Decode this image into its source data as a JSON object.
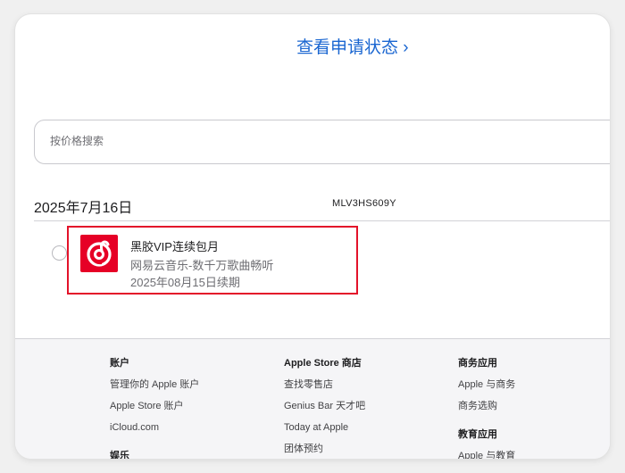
{
  "request_status_link": "查看申请状态 ›",
  "search": {
    "placeholder": "按价格搜索"
  },
  "order": {
    "date": "2025年7月16日",
    "id": "MLV3HS609Y",
    "item": {
      "title": "黑胶VIP连续包月",
      "app": "网易云音乐-数千万歌曲畅听",
      "renewal": "2025年08月15日续期",
      "icon": "netease-cloud-music-icon",
      "icon_color": "#e60026"
    }
  },
  "highlight_color": "#e3122a",
  "footer": {
    "col1": {
      "heading": "账户",
      "links": [
        "管理你的 Apple 账户",
        "Apple Store 账户",
        "iCloud.com"
      ],
      "heading2": "娱乐"
    },
    "col2": {
      "heading": "Apple Store 商店",
      "links": [
        "查找零售店",
        "Genius Bar 天才吧",
        "Today at Apple",
        "团体预约"
      ]
    },
    "col3": {
      "heading": "商务应用",
      "links": [
        "Apple 与商务",
        "商务选购"
      ],
      "heading2": "教育应用",
      "links2": [
        "Apple 与教育"
      ]
    }
  }
}
